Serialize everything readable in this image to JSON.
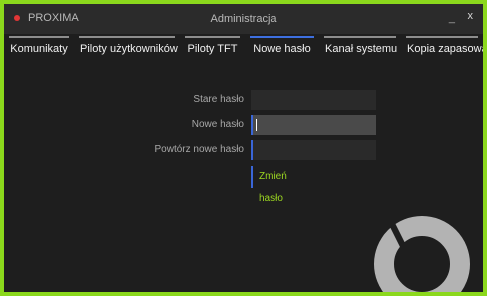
{
  "app": {
    "name": "PROXIMA",
    "accent": "#8bd81c",
    "dot_color": "#e23636"
  },
  "window": {
    "title": "Administracja",
    "minimize": "_",
    "close": "x"
  },
  "tabs": [
    {
      "label": "Komunikaty"
    },
    {
      "label": "Piloty użytkowników"
    },
    {
      "label": "Piloty TFT"
    },
    {
      "label": "Nowe hasło"
    },
    {
      "label": "Kanał systemu"
    },
    {
      "label": "Kopia zapasowa"
    }
  ],
  "active_tab": "Nowe hasło",
  "form": {
    "old_password_label": "Stare hasło",
    "old_password_value": "",
    "new_password_label": "Nowe hasło",
    "new_password_value": "",
    "repeat_password_label": "Powtórz nowe hasło",
    "repeat_password_value": "",
    "submit_label": "Zmień hasło",
    "submit_color": "#9bd621"
  },
  "logo": {
    "icon": "proxima-ring-logo"
  }
}
